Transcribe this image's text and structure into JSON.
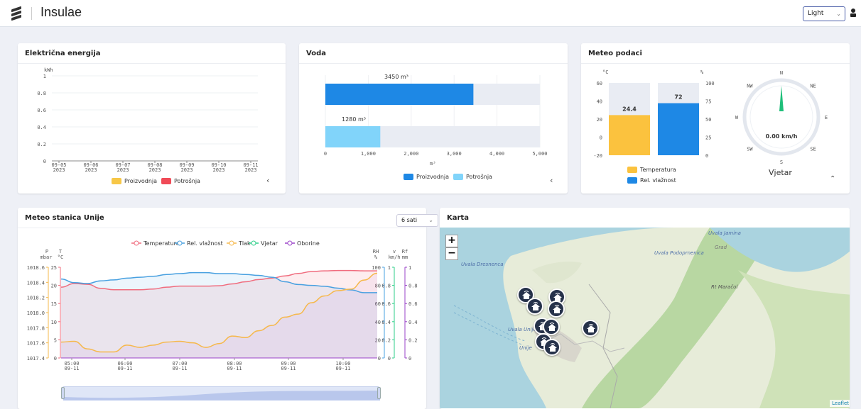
{
  "header": {
    "title": "Insulae",
    "theme": "Light"
  },
  "electricity": {
    "title": "Električna energija",
    "unit": "kWh",
    "y_ticks": [
      "1",
      "0.8",
      "0.6",
      "0.4",
      "0.2",
      "0"
    ],
    "x_dates": [
      "09-05",
      "09-06",
      "09-07",
      "09-08",
      "09-09",
      "09-10",
      "09-11"
    ],
    "x_year": "2023",
    "legend": {
      "production": "Proizvodnja",
      "consumption": "Potrošnja"
    },
    "colors": {
      "production": "#f7c747",
      "consumption": "#f04a57"
    }
  },
  "water": {
    "title": "Voda",
    "unit": "m³",
    "x_ticks": [
      "0",
      "1,000",
      "2,000",
      "3,000",
      "4,000",
      "5,000"
    ],
    "legend": {
      "production": "Proizvodnja",
      "consumption": "Potrošnja"
    },
    "colors": {
      "production": "#1e88e5",
      "consumption": "#81d4fa"
    }
  },
  "meteo": {
    "title": "Meteo podaci",
    "temp_unit": "°C",
    "hum_unit": "%",
    "temp_ticks": [
      "60",
      "40",
      "20",
      "0",
      "-20"
    ],
    "hum_ticks": [
      "100",
      "75",
      "50",
      "25",
      "0"
    ],
    "legend": {
      "temperature": "Temperatura",
      "humidity": "Rel. vlažnost"
    },
    "colors": {
      "temperature": "#fbc23e",
      "humidity": "#1e88e5"
    },
    "wind": {
      "label": "Vjetar",
      "speed": "0.00 km/h",
      "directions": [
        "N",
        "NE",
        "E",
        "SE",
        "S",
        "SW",
        "W",
        "NW"
      ]
    }
  },
  "station": {
    "title": "Meteo stanica Unije",
    "range": "6 sati",
    "legend": [
      "Temperatura",
      "Rel. vlažnost",
      "Tlak",
      "Vjetar",
      "Oborine"
    ],
    "axis_left": {
      "p_label": "P",
      "p_unit": "mbar",
      "t_label": "T",
      "t_unit": "°C"
    },
    "axis_right": {
      "rh_label": "RH",
      "rh_unit": "%",
      "v_label": "v",
      "v_unit": "km/h",
      "rf_label": "Rf",
      "rf_unit": "mm"
    },
    "p_ticks": [
      "1018.6",
      "1018.4",
      "1018.2",
      "1018.0",
      "1017.8",
      "1017.6",
      "1017.4"
    ],
    "t_ticks": [
      "25",
      "20",
      "15",
      "10",
      "5",
      "0"
    ],
    "rh_ticks": [
      "100",
      "80",
      "60",
      "40",
      "20",
      "0"
    ],
    "v_ticks": [
      "1",
      "0.8",
      "0.6",
      "0.4",
      "0.2",
      "0"
    ],
    "rf_ticks": [
      "1",
      "0.8",
      "0.6",
      "0.4",
      "0.2",
      "0"
    ],
    "x_times": [
      "05:00",
      "06:00",
      "07:00",
      "08:00",
      "09:00",
      "10:00"
    ],
    "x_date": "09-11",
    "colors": {
      "temperature": "#f06c7e",
      "humidity": "#48a0e0",
      "pressure": "#f6b84b",
      "wind": "#2fcf8a",
      "rain": "#9a43c8"
    }
  },
  "map": {
    "title": "Karta",
    "zoom_in": "+",
    "zoom_out": "−",
    "labels": [
      "Uvala Jamina",
      "Grad",
      "Uvala Podoprnenica",
      "Rt Maračol",
      "Uvala Dresnenca",
      "Uvala Unije",
      "Unije"
    ],
    "attribution": "Leaflet"
  },
  "chart_data": [
    {
      "type": "bar",
      "title": "Električna energija",
      "ylabel": "kWh",
      "categories": [
        "09-05 2023",
        "09-06 2023",
        "09-07 2023",
        "09-08 2023",
        "09-09 2023",
        "09-10 2023",
        "09-11 2023"
      ],
      "series": [
        {
          "name": "Proizvodnja",
          "values": [
            0,
            0,
            0,
            0,
            0,
            0,
            0
          ]
        },
        {
          "name": "Potrošnja",
          "values": [
            0,
            0,
            0,
            0,
            0,
            0,
            0
          ]
        }
      ],
      "ylim": [
        0,
        1
      ]
    },
    {
      "type": "bar",
      "title": "Voda",
      "xlabel": "m³",
      "orientation": "horizontal",
      "series": [
        {
          "name": "Proizvodnja",
          "values": [
            3450
          ],
          "label": "3450 m³"
        },
        {
          "name": "Potrošnja",
          "values": [
            1280
          ],
          "label": "1280 m³"
        }
      ],
      "xlim": [
        0,
        5000
      ]
    },
    {
      "type": "bar",
      "title": "Meteo podaci",
      "series": [
        {
          "name": "Temperatura",
          "values": [
            24.4
          ],
          "label": "24.4",
          "ylim": [
            -20,
            60
          ]
        },
        {
          "name": "Rel. vlažnost",
          "values": [
            72
          ],
          "label": "72",
          "ylim": [
            0,
            100
          ]
        }
      ],
      "wind_speed": 0.0
    },
    {
      "type": "line",
      "title": "Meteo stanica Unije",
      "x": [
        "04:45",
        "05:00",
        "05:15",
        "05:30",
        "05:45",
        "06:00",
        "06:15",
        "06:30",
        "06:45",
        "07:00",
        "07:15",
        "07:30",
        "07:45",
        "08:00",
        "08:15",
        "08:30",
        "08:45",
        "09:00",
        "09:15",
        "09:30",
        "09:45",
        "10:00",
        "10:15",
        "10:30",
        "10:40"
      ],
      "series": [
        {
          "name": "Temperatura",
          "axis": "T °C",
          "values": [
            19.5,
            20.5,
            20.3,
            19.2,
            18.8,
            18.8,
            18.8,
            19.0,
            19.5,
            19.8,
            19.8,
            19.8,
            19.9,
            20.4,
            21.0,
            21.6,
            22.0,
            22.6,
            23.3,
            23.8,
            24.0,
            24.1,
            24.1,
            24.0,
            24.0
          ]
        },
        {
          "name": "Rel. vlažnost",
          "axis": "RH %",
          "values": [
            87,
            83,
            82,
            85,
            86,
            88,
            89,
            90,
            92,
            93,
            94,
            94,
            93,
            93,
            92,
            91,
            89,
            84,
            81,
            80,
            79,
            77,
            75,
            72,
            72
          ]
        },
        {
          "name": "Tlak",
          "axis": "P mbar",
          "values": [
            1017.61,
            1017.62,
            1017.52,
            1017.48,
            1017.48,
            1017.57,
            1017.54,
            1017.57,
            1017.61,
            1017.62,
            1017.6,
            1017.54,
            1017.59,
            1017.69,
            1017.67,
            1017.76,
            1017.83,
            1017.94,
            1017.98,
            1018.13,
            1018.22,
            1018.29,
            1018.31,
            1018.43,
            1018.52
          ]
        },
        {
          "name": "Vjetar",
          "axis": "v km/h",
          "values": [
            0,
            0,
            0,
            0,
            0,
            0,
            0,
            0,
            0,
            0,
            0,
            0,
            0,
            0,
            0,
            0,
            0,
            0,
            0,
            0,
            0,
            0,
            0,
            0,
            0
          ]
        },
        {
          "name": "Oborine",
          "axis": "Rf mm",
          "values": [
            0,
            0,
            0,
            0,
            0,
            0,
            0,
            0,
            0,
            0,
            0,
            0,
            0,
            0,
            0,
            0,
            0,
            0,
            0,
            0,
            0,
            0,
            0,
            0,
            0
          ]
        }
      ],
      "pressure_range": [
        1017.4,
        1018.6
      ],
      "temperature_range": [
        0,
        25
      ],
      "humidity_range": [
        0,
        100
      ]
    }
  ]
}
